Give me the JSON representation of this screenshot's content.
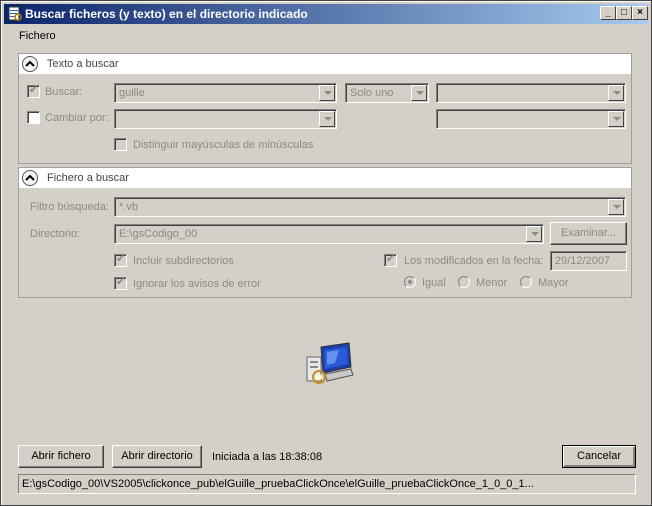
{
  "window": {
    "title": "Buscar ficheros (y texto) en el directorio indicado"
  },
  "caption_buttons": {
    "minimize": "_",
    "maximize": "□",
    "close": "×"
  },
  "menu": {
    "items": [
      {
        "label": "Fichero"
      }
    ]
  },
  "text_section": {
    "title": "Texto a buscar",
    "search_label": "Buscar:",
    "search_checked": true,
    "search_value": "guille",
    "mode_value": "Solo uno",
    "search_extra_value": "",
    "replace_label": "Cambiar por:",
    "replace_checked": false,
    "replace_value": "",
    "replace_extra_value": "",
    "case_label": "Distinguir mayúsculas de minúsculas",
    "case_checked": false
  },
  "file_section": {
    "title": "Fichero a buscar",
    "filter_label": "Filtro búsqueda:",
    "filter_value": "*.vb",
    "dir_label": "Directorio:",
    "dir_value": "E:\\gsCodigo_00",
    "browse_label": "Examinar...",
    "subdirs_label": "Incluir subdirectorios",
    "subdirs_checked": true,
    "ignore_errors_label": "Ignorar los avisos de error",
    "ignore_errors_checked": true,
    "modified_label": "Los modificados en la fecha:",
    "modified_checked": true,
    "date_value": "29/12/2007",
    "radio_options": [
      {
        "label": "Igual",
        "selected": true
      },
      {
        "label": "Menor",
        "selected": false
      },
      {
        "label": "Mayor",
        "selected": false
      }
    ]
  },
  "center_icon": "search-computer-icon",
  "footer": {
    "open_file_label": "Abrir fichero",
    "open_dir_label": "Abrir directorio",
    "status": "Iniciada a las 18:38:08",
    "cancel_label": "Cancelar",
    "statusbar_text": "E:\\gsCodigo_00\\VS2005\\clickonce_pub\\elGuille_pruebaClickOnce\\elGuille_pruebaClickOnce_1_0_0_1..."
  },
  "colors": {
    "title_gradient_start": "#0a246a",
    "title_gradient_end": "#a6caf0",
    "face": "#d4d0c8"
  }
}
